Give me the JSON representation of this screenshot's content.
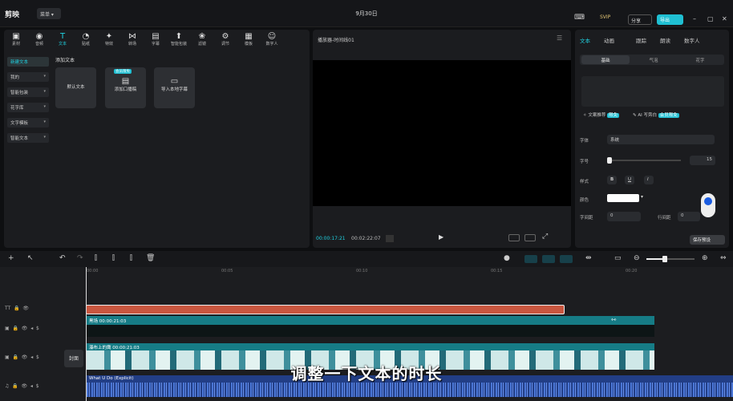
{
  "titlebar": {
    "logo": "剪映",
    "menu": "菜单",
    "date": "9月30日",
    "vip": "SVIP",
    "share": "分享",
    "export": "导出"
  },
  "media": {
    "tabs": [
      {
        "label": "素材",
        "icon": "media-icon"
      },
      {
        "label": "音频",
        "icon": "audio-icon"
      },
      {
        "label": "文本",
        "icon": "text-icon"
      },
      {
        "label": "贴纸",
        "icon": "sticker-icon"
      },
      {
        "label": "特效",
        "icon": "effect-icon"
      },
      {
        "label": "转场",
        "icon": "transition-icon"
      },
      {
        "label": "字幕",
        "icon": "caption-icon"
      },
      {
        "label": "智能包装",
        "icon": "smart-pack-icon"
      },
      {
        "label": "滤镜",
        "icon": "filter-icon"
      },
      {
        "label": "调节",
        "icon": "adjust-icon"
      },
      {
        "label": "模板",
        "icon": "template-icon"
      },
      {
        "label": "数字人",
        "icon": "avatar-icon"
      }
    ],
    "active_tab": "文本",
    "sidebar": [
      "新建文本",
      "我的",
      "智能包装",
      "花字库",
      "文字模板",
      "智能文本"
    ],
    "section_title": "添加文本",
    "cards": [
      {
        "label": "默认文本"
      },
      {
        "label": "添加口播稿",
        "badge": "会员限免"
      },
      {
        "label": "导入本地字幕"
      }
    ]
  },
  "player": {
    "title": "播放器-时间线01",
    "current_time": "00:00:17:21",
    "total_time": "00:02:22:07"
  },
  "props": {
    "tabs": [
      "文本",
      "动画",
      "跟踪",
      "朗读",
      "数字人"
    ],
    "subtabs": [
      "基础",
      "气泡",
      "花字"
    ],
    "recommend": "文案推荐",
    "recommend_badge": "限免",
    "ai_write": "AI 写旁白",
    "ai_badge": "会员限免",
    "font_label": "字体",
    "font_value": "系统",
    "size_label": "字号",
    "size_value": "15",
    "style_label": "样式",
    "style_buttons": [
      "B",
      "U",
      "I"
    ],
    "color_label": "颜色",
    "char_spacing_label": "字间距",
    "char_spacing_value": "0",
    "line_spacing_label": "行间距",
    "line_spacing_value": "0",
    "save_label": "保存预设"
  },
  "timeline": {
    "ticks": [
      "00:00",
      "00:05",
      "00:10",
      "00:15",
      "00:20"
    ],
    "clip_a_label": "黑场  00:00:21:03",
    "clip_b_label": "瀑布上的鹰  00:00:21:03",
    "cover_label": "封面",
    "audio_label": "What U Do (Explicit)"
  },
  "subtitle": "调整一下文本的时长"
}
